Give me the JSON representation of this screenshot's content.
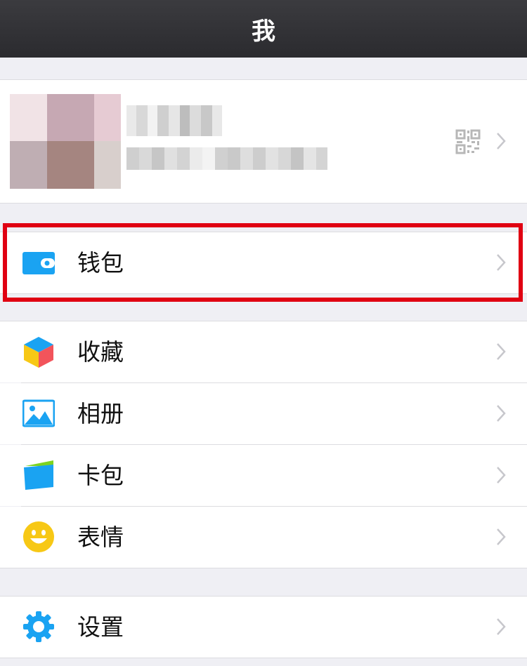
{
  "navbar": {
    "title": "我"
  },
  "profile": {
    "qr_icon": "qr-code-icon",
    "chevron_icon": "chevron-right-icon"
  },
  "wallet": {
    "label": "钱包",
    "icon": "wallet-icon"
  },
  "menu": {
    "favorites": {
      "label": "收藏",
      "icon": "cube-favorites-icon"
    },
    "photos": {
      "label": "相册",
      "icon": "photo-album-icon"
    },
    "cards": {
      "label": "卡包",
      "icon": "card-pack-icon"
    },
    "stickers": {
      "label": "表情",
      "icon": "smiley-icon"
    }
  },
  "settings": {
    "label": "设置",
    "icon": "gear-icon"
  },
  "colors": {
    "navbar_bg": "#2f2f33",
    "background": "#efeff4",
    "highlight_border": "#e00012",
    "icon_blue": "#1aa3f2",
    "icon_yellow": "#f7c815"
  }
}
